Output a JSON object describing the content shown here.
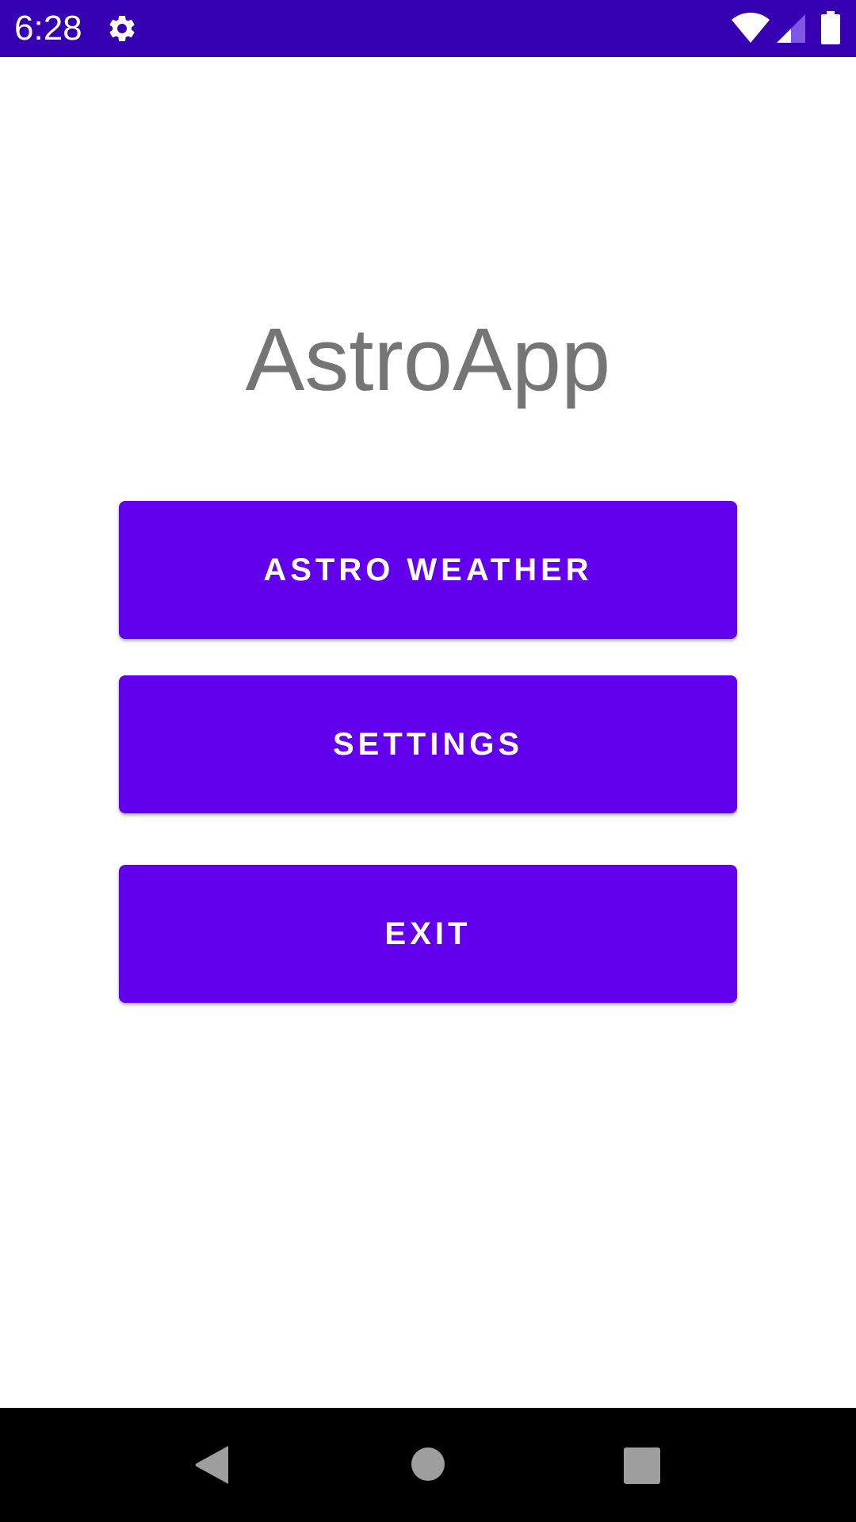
{
  "status_bar": {
    "time": "6:28",
    "icons": [
      "settings-icon",
      "wifi-icon",
      "signal-icon",
      "battery-icon"
    ],
    "background_color": "#3700b3"
  },
  "app": {
    "title": "AstroApp",
    "title_color": "#757575"
  },
  "menu": {
    "button_color": "#6200ee",
    "astro_weather_label": "ASTRO WEATHER",
    "settings_label": "SETTINGS",
    "exit_label": "EXIT"
  },
  "nav_bar": {
    "icons": [
      "back-icon",
      "home-icon",
      "recents-icon"
    ],
    "background_color": "#000000"
  }
}
